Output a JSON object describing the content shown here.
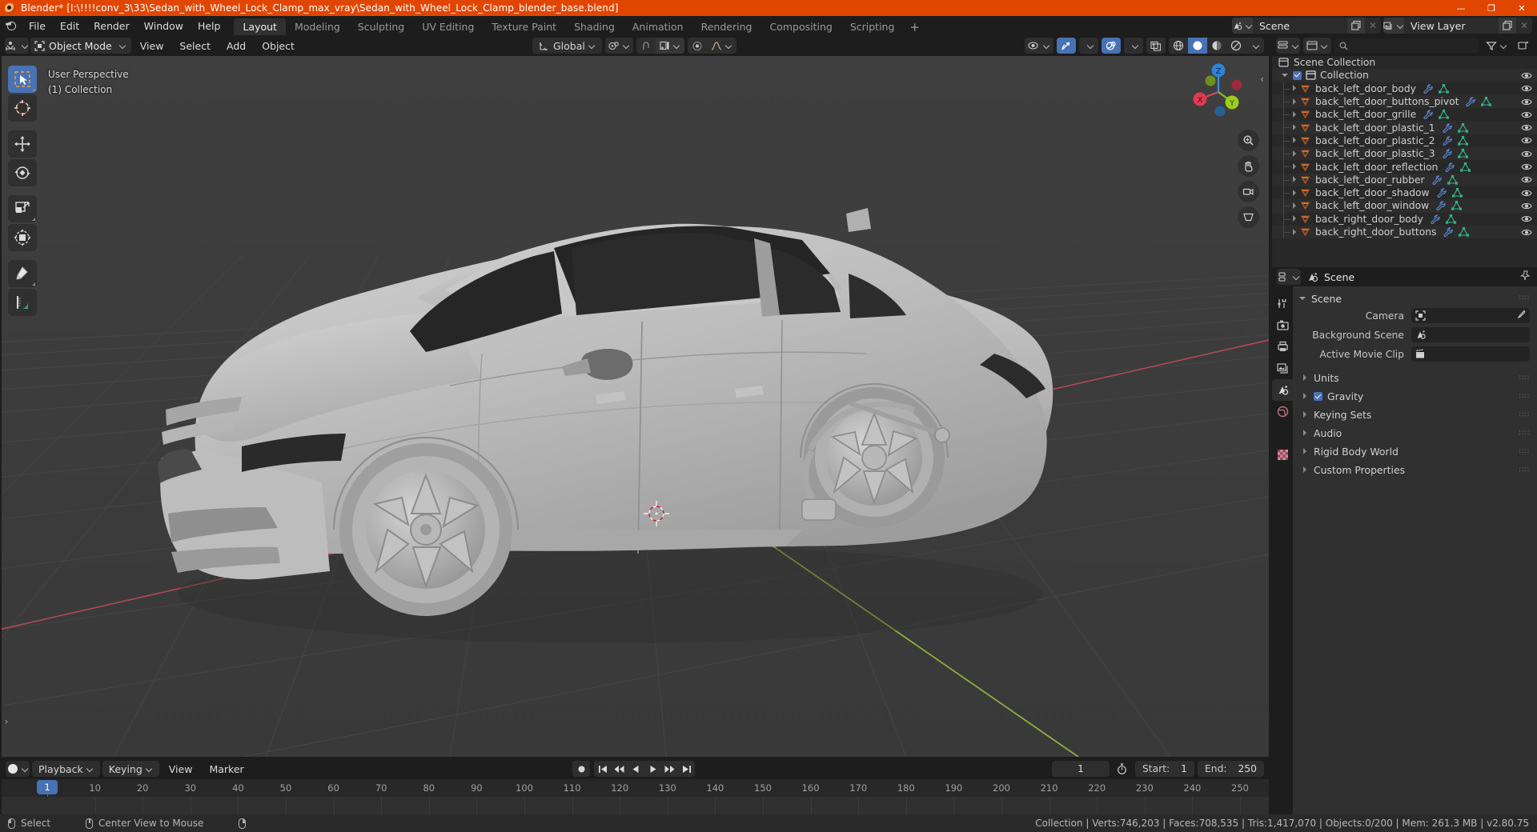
{
  "window": {
    "title": "Blender* [I:\\!!!!conv_3\\33\\Sedan_with_Wheel_Lock_Clamp_max_vray\\Sedan_with_Wheel_Lock_Clamp_blender_base.blend]",
    "minimize": "—",
    "maximize": "❐",
    "close": "✕"
  },
  "topbar": {
    "menus": [
      "File",
      "Edit",
      "Render",
      "Window",
      "Help"
    ],
    "workspaces": [
      {
        "label": "Layout",
        "active": true
      },
      {
        "label": "Modeling",
        "active": false
      },
      {
        "label": "Sculpting",
        "active": false
      },
      {
        "label": "UV Editing",
        "active": false
      },
      {
        "label": "Texture Paint",
        "active": false
      },
      {
        "label": "Shading",
        "active": false
      },
      {
        "label": "Animation",
        "active": false
      },
      {
        "label": "Rendering",
        "active": false
      },
      {
        "label": "Compositing",
        "active": false
      },
      {
        "label": "Scripting",
        "active": false
      }
    ],
    "add_workspace": "+",
    "scene_name": "Scene",
    "view_layer_name": "View Layer"
  },
  "viewport": {
    "mode": "Object Mode",
    "menus": [
      "View",
      "Select",
      "Add",
      "Object"
    ],
    "transform_orientation": "Global",
    "overlay_text_line1": "User Perspective",
    "overlay_text_line2": "(1) Collection",
    "gizmo_axes": [
      "X",
      "Y",
      "Z"
    ]
  },
  "tools": [
    {
      "name": "select-box-tool",
      "active": true
    },
    {
      "name": "cursor-tool",
      "active": false
    },
    {
      "name": "move-tool",
      "active": false
    },
    {
      "name": "rotate-tool",
      "active": false
    },
    {
      "name": "scale-tool",
      "active": false
    },
    {
      "name": "transform-tool",
      "active": false
    },
    {
      "name": "annotate-tool",
      "active": false
    },
    {
      "name": "measure-tool",
      "active": false
    }
  ],
  "outliner": {
    "scene_collection": "Scene Collection",
    "collection": "Collection",
    "items": [
      "back_left_door_body",
      "back_left_door_buttons_pivot",
      "back_left_door_grille",
      "back_left_door_plastic_1",
      "back_left_door_plastic_2",
      "back_left_door_plastic_3",
      "back_left_door_reflection",
      "back_left_door_rubber",
      "back_left_door_shadow",
      "back_left_door_window",
      "back_right_door_body",
      "back_right_door_buttons"
    ]
  },
  "properties": {
    "breadcrumb": "Scene",
    "panel_title": "Scene",
    "rows": [
      {
        "label": "Camera",
        "value": ""
      },
      {
        "label": "Background Scene",
        "value": ""
      },
      {
        "label": "Active Movie Clip",
        "value": ""
      }
    ],
    "sections": [
      {
        "label": "Units",
        "checkbox": false
      },
      {
        "label": "Gravity",
        "checkbox": true
      },
      {
        "label": "Keying Sets",
        "checkbox": false
      },
      {
        "label": "Audio",
        "checkbox": false
      },
      {
        "label": "Rigid Body World",
        "checkbox": false
      },
      {
        "label": "Custom Properties",
        "checkbox": false
      }
    ]
  },
  "timeline": {
    "menus": [
      "Playback",
      "Keying",
      "View",
      "Marker"
    ],
    "current_frame": "1",
    "start_label": "Start:",
    "start_value": "1",
    "end_label": "End:",
    "end_value": "250",
    "ticks": [
      "10",
      "20",
      "30",
      "40",
      "50",
      "60",
      "70",
      "80",
      "90",
      "100",
      "110",
      "120",
      "130",
      "140",
      "150",
      "160",
      "170",
      "180",
      "190",
      "200",
      "210",
      "220",
      "230",
      "240",
      "250"
    ],
    "playhead_label": "1"
  },
  "status": {
    "left_action": "Select",
    "middle_action": "Center View to Mouse",
    "stats": "Collection | Verts:746,203 | Faces:708,535 | Tris:1,417,070 | Objects:0/200 | Mem: 261.3 MB | v2.80.75"
  },
  "colors": {
    "accent": "#4772b3",
    "title_bar": "#e14600",
    "mesh_orange": "#e8762c",
    "viewport_bg": "#3d3d3d",
    "axis_x": "#e04860",
    "axis_y": "#9ac12a"
  }
}
